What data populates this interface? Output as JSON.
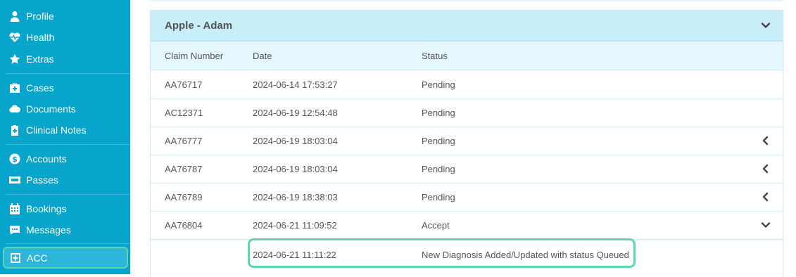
{
  "sidebar": {
    "items": [
      {
        "label": "Profile",
        "icon": "user-icon"
      },
      {
        "label": "Health",
        "icon": "heartbeat-icon"
      },
      {
        "label": "Extras",
        "icon": "star-icon"
      },
      {
        "label": "Cases",
        "icon": "medical-briefcase-icon"
      },
      {
        "label": "Documents",
        "icon": "cloud-icon"
      },
      {
        "label": "Clinical Notes",
        "icon": "clipboard-plus-icon"
      },
      {
        "label": "Accounts",
        "icon": "dollar-circle-icon"
      },
      {
        "label": "Passes",
        "icon": "ticket-icon"
      },
      {
        "label": "Bookings",
        "icon": "calendar-icon"
      },
      {
        "label": "Messages",
        "icon": "chat-icon"
      },
      {
        "label": "ACC",
        "icon": "plus-square-icon",
        "active": true
      }
    ]
  },
  "panel": {
    "title": "Apple - Adam",
    "columns": [
      "Claim Number",
      "Date",
      "Status"
    ],
    "rows": [
      {
        "claim": "AA76717",
        "date": "2024-06-14 17:53:27",
        "status": "Pending",
        "chevron": "none"
      },
      {
        "claim": "AC12371",
        "date": "2024-06-19 12:54:48",
        "status": "Pending",
        "chevron": "none"
      },
      {
        "claim": "AA76777",
        "date": "2024-06-19 18:03:04",
        "status": "Pending",
        "chevron": "left"
      },
      {
        "claim": "AA76787",
        "date": "2024-06-19 18:03:04",
        "status": "Pending",
        "chevron": "left"
      },
      {
        "claim": "AA76789",
        "date": "2024-06-19 18:38:03",
        "status": "Pending",
        "chevron": "left"
      },
      {
        "claim": "AA76804",
        "date": "2024-06-21 11:09:52",
        "status": "Accept",
        "chevron": "down"
      }
    ],
    "detail": {
      "date": "2024-06-21 11:11:22",
      "status": "New Diagnosis Added/Updated with status Queued"
    }
  },
  "colors": {
    "sidebar": "#07a4cc",
    "header": "#c8eefa",
    "highlight": "#5fd5b0"
  }
}
